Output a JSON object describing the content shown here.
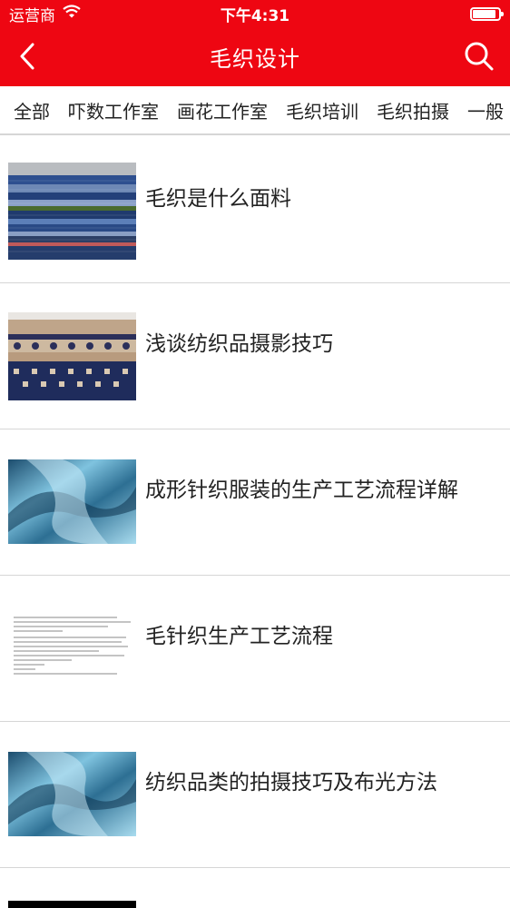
{
  "status": {
    "carrier": "运营商",
    "time": "下午4:31",
    "battery_level": 0.9
  },
  "nav": {
    "title": "毛织设计",
    "back_icon": "chevron-left-icon",
    "search_icon": "search-icon"
  },
  "tabs": [
    {
      "label": "全部"
    },
    {
      "label": "吓数工作室"
    },
    {
      "label": "画花工作室"
    },
    {
      "label": "毛织培训"
    },
    {
      "label": "毛织拍摄"
    },
    {
      "label": "一般"
    }
  ],
  "articles": [
    {
      "title": "毛织是什么面料",
      "thumb": "knit-stripes"
    },
    {
      "title": "浅谈纺织品摄影技巧",
      "thumb": "fair-isle-sweater"
    },
    {
      "title": "成形针织服装的生产工艺流程详解",
      "thumb": "blue-satin"
    },
    {
      "title": "毛针织生产工艺流程",
      "thumb": "text-document"
    },
    {
      "title": "纺织品类的拍摄技巧及布光方法",
      "thumb": "blue-satin"
    }
  ],
  "colors": {
    "brand_red": "#ee0612",
    "divider": "#d6d6d6"
  }
}
